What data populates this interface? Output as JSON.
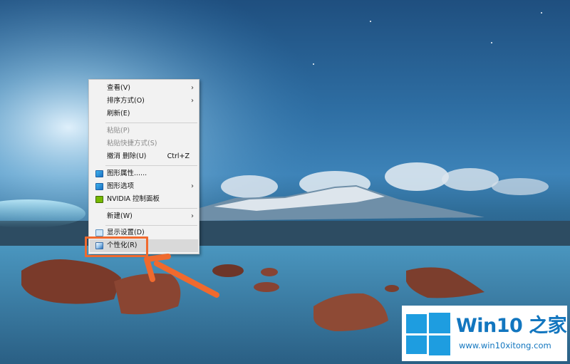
{
  "context_menu": {
    "items": [
      {
        "label": "查看(V)",
        "has_submenu": true,
        "disabled": false
      },
      {
        "label": "排序方式(O)",
        "has_submenu": true,
        "disabled": false
      },
      {
        "label": "刷新(E)",
        "has_submenu": false,
        "disabled": false
      },
      {
        "label": "粘贴(P)",
        "has_submenu": false,
        "disabled": true
      },
      {
        "label": "粘贴快捷方式(S)",
        "has_submenu": false,
        "disabled": true
      },
      {
        "label": "撤消 删除(U)",
        "shortcut": "Ctrl+Z",
        "has_submenu": false,
        "disabled": false
      },
      {
        "label": "图形属性......",
        "icon": "intel-graphics-icon",
        "has_submenu": false,
        "disabled": false
      },
      {
        "label": "图形选项",
        "icon": "intel-graphics-icon",
        "has_submenu": true,
        "disabled": false
      },
      {
        "label": "NVIDIA 控制面板",
        "icon": "nvidia-icon",
        "has_submenu": false,
        "disabled": false
      },
      {
        "label": "新建(W)",
        "has_submenu": true,
        "disabled": false
      },
      {
        "label": "显示设置(D)",
        "icon": "display-settings-icon",
        "has_submenu": false,
        "disabled": false
      },
      {
        "label": "个性化(R)",
        "icon": "personalize-icon",
        "has_submenu": false,
        "disabled": false,
        "highlighted": true
      }
    ],
    "submenu_arrow": "›"
  },
  "annotation": {
    "highlight_color": "#f06a2e",
    "target": "个性化(R)"
  },
  "watermark": {
    "title": "Win10 之家",
    "url": "www.win10xitong.com",
    "brand_color": "#1276bf",
    "logo_color": "#1e9de0"
  }
}
